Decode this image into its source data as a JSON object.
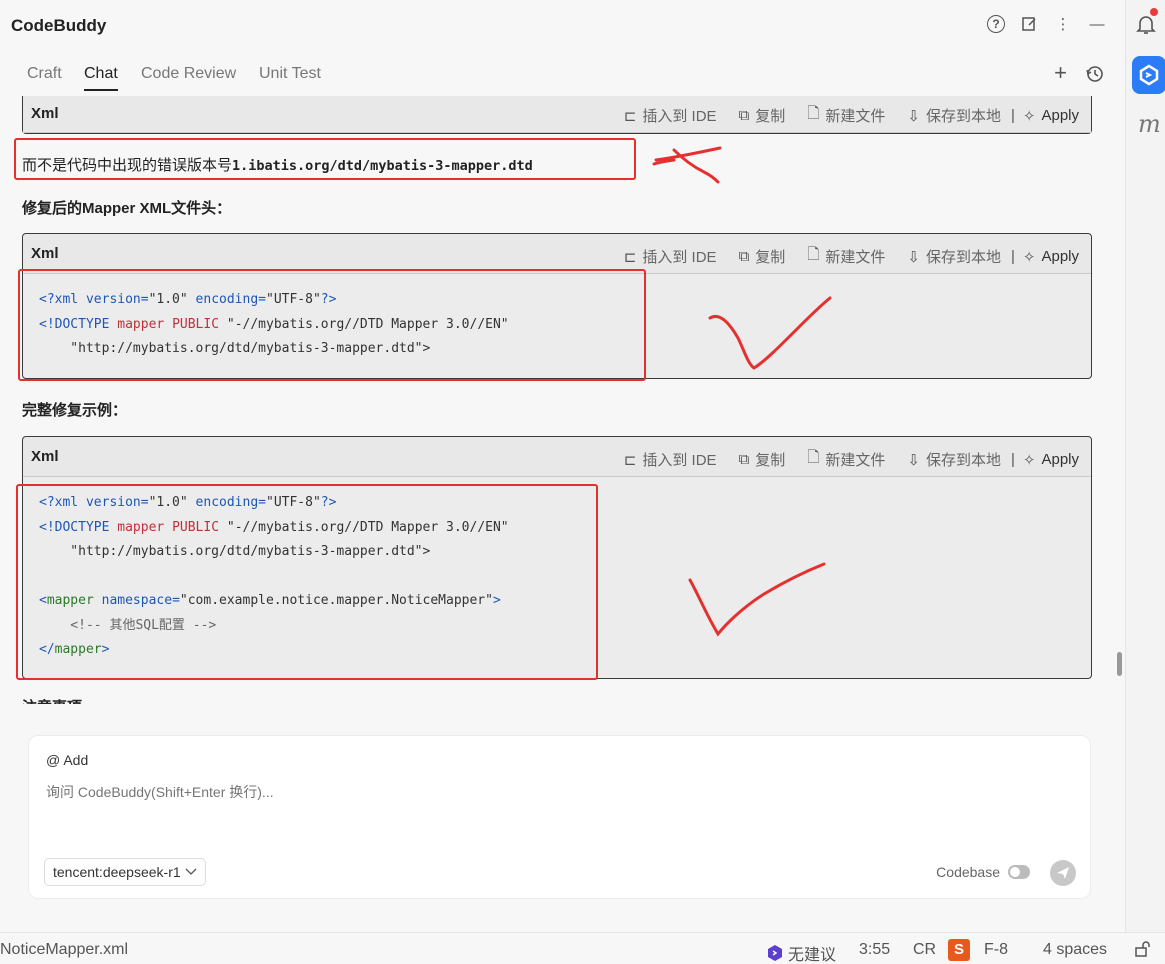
{
  "header": {
    "title": "CodeBuddy",
    "icons": [
      "help-icon",
      "edit-icon",
      "more-icon",
      "minimize-icon"
    ]
  },
  "tabs": [
    {
      "label": "Craft",
      "active": false
    },
    {
      "label": "Chat",
      "active": true
    },
    {
      "label": "Code Review",
      "active": false
    },
    {
      "label": "Unit Test",
      "active": false
    }
  ],
  "tab_actions": [
    "plus-icon",
    "history-icon"
  ],
  "code_toolbar": {
    "lang": "Xml",
    "insert_ide": "插入到 IDE",
    "copy": "复制",
    "new_file": "新建文件",
    "save_local": "保存到本地",
    "separator": "|",
    "apply": "Apply"
  },
  "content": {
    "note_text": "而不是代码中出现的错误版本号",
    "note_mono": "1.ibatis.org/dtd/mybatis-3-mapper.dtd",
    "heading_fixed": "修复后的Mapper XML文件头：",
    "heading_full": "完整修复示例：",
    "heading_cut": "注意事项"
  },
  "code_fixed": {
    "l1_decl": "<?xml version=",
    "l1_ver": "\"1.0\"",
    "l1_enc": " encoding=",
    "l1_encv": "\"UTF-8\"",
    "l1_end": "?>",
    "l2_doctype": "<!DOCTYPE ",
    "l2_mapper": "mapper",
    "l2_public": " PUBLIC ",
    "l2_str": "\"-//mybatis.org//DTD Mapper 3.0//EN\"",
    "l3_str": "    \"http://mybatis.org/dtd/mybatis-3-mapper.dtd\">"
  },
  "code_full": {
    "l5_open": "<",
    "l5_tag": "mapper",
    "l5_attr": " namespace=",
    "l5_val": "\"com.example.notice.mapper.NoticeMapper\"",
    "l5_close": ">",
    "l6_comment": "    <!-- 其他SQL配置 -->",
    "l7_open": "</",
    "l7_tag": "mapper",
    "l7_close": ">"
  },
  "input": {
    "add_label": "@ Add",
    "placeholder": "询问 CodeBuddy(Shift+Enter 换行)...",
    "model": "tencent:deepseek-r1",
    "codebase_label": "Codebase"
  },
  "statusbar": {
    "filename": "NoticeMapper.xml",
    "suggestion": "无建议",
    "position": "3:55",
    "line_ending": "CR",
    "encoding": "F-8",
    "indent": "4 spaces"
  },
  "colors": {
    "annotation_red": "#e53030",
    "brand_blue": "#2b7cf6"
  }
}
